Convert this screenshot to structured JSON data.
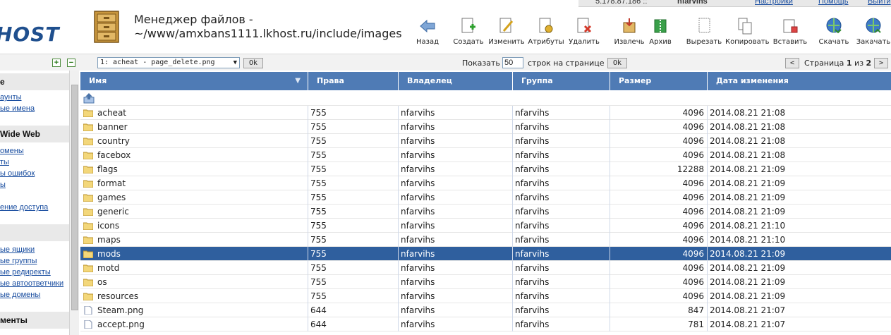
{
  "top": {
    "ip": "5.178.87.186 ::",
    "user": "nfarvihs",
    "settings": "Настройки",
    "help": "Помощь",
    "logout": "Выйти"
  },
  "header": {
    "logo": "HOST",
    "title_line1": "Менеджер файлов -",
    "title_line2": "~/www/amxbans1111.lkhost.ru/include/images"
  },
  "toolbar": [
    {
      "label": "Назад",
      "icon": "back-arrow-icon"
    },
    {
      "label": "Создать",
      "icon": "create-file-icon"
    },
    {
      "label": "Изменить",
      "icon": "edit-file-icon"
    },
    {
      "label": "Атрибуты",
      "icon": "attributes-icon"
    },
    {
      "label": "Удалить",
      "icon": "delete-file-icon"
    },
    {
      "label": "Извлечь",
      "icon": "extract-icon"
    },
    {
      "label": "Архив",
      "icon": "archive-icon"
    },
    {
      "label": "Вырезать",
      "icon": "cut-icon"
    },
    {
      "label": "Копировать",
      "icon": "copy-icon"
    },
    {
      "label": "Вставить",
      "icon": "paste-icon"
    },
    {
      "label": "Скачать",
      "icon": "download-icon"
    },
    {
      "label": "Закачать",
      "icon": "upload-icon"
    }
  ],
  "subbar": {
    "select_value": "1: acheat - page_delete.png",
    "ok": "Ok",
    "show_label": "Показать",
    "per_page": "50",
    "rows_label": "строк на странице",
    "prev": "<",
    "page_label": "Страница",
    "page_current": "1",
    "page_of": "из",
    "page_total": "2",
    "next": ">"
  },
  "sidebar": {
    "sections": [
      {
        "title": "e",
        "links": [
          "аунты",
          "ые имена"
        ]
      },
      {
        "title": "Wide Web",
        "links": [
          "омены",
          "ты",
          "ы ошибок",
          "ы",
          "ение доступа"
        ]
      },
      {
        "title": "",
        "links": [
          "ые ящики",
          "ые группы",
          "ые редиректы",
          "ые автоответчики",
          "ые домены"
        ]
      },
      {
        "title": "менты",
        "links": []
      }
    ]
  },
  "table": {
    "headers": [
      "Имя",
      "Права",
      "Владелец",
      "Группа",
      "Размер",
      "Дата изменения"
    ],
    "rows": [
      {
        "name": "acheat",
        "type": "folder",
        "perm": "755",
        "owner": "nfarvihs",
        "group": "nfarvihs",
        "size": "4096",
        "date": "2014.08.21 21:08"
      },
      {
        "name": "banner",
        "type": "folder",
        "perm": "755",
        "owner": "nfarvihs",
        "group": "nfarvihs",
        "size": "4096",
        "date": "2014.08.21 21:08"
      },
      {
        "name": "country",
        "type": "folder",
        "perm": "755",
        "owner": "nfarvihs",
        "group": "nfarvihs",
        "size": "4096",
        "date": "2014.08.21 21:08"
      },
      {
        "name": "facebox",
        "type": "folder",
        "perm": "755",
        "owner": "nfarvihs",
        "group": "nfarvihs",
        "size": "4096",
        "date": "2014.08.21 21:08"
      },
      {
        "name": "flags",
        "type": "folder",
        "perm": "755",
        "owner": "nfarvihs",
        "group": "nfarvihs",
        "size": "12288",
        "date": "2014.08.21 21:09"
      },
      {
        "name": "format",
        "type": "folder",
        "perm": "755",
        "owner": "nfarvihs",
        "group": "nfarvihs",
        "size": "4096",
        "date": "2014.08.21 21:09"
      },
      {
        "name": "games",
        "type": "folder",
        "perm": "755",
        "owner": "nfarvihs",
        "group": "nfarvihs",
        "size": "4096",
        "date": "2014.08.21 21:09"
      },
      {
        "name": "generic",
        "type": "folder",
        "perm": "755",
        "owner": "nfarvihs",
        "group": "nfarvihs",
        "size": "4096",
        "date": "2014.08.21 21:09"
      },
      {
        "name": "icons",
        "type": "folder",
        "perm": "755",
        "owner": "nfarvihs",
        "group": "nfarvihs",
        "size": "4096",
        "date": "2014.08.21 21:10"
      },
      {
        "name": "maps",
        "type": "folder",
        "perm": "755",
        "owner": "nfarvihs",
        "group": "nfarvihs",
        "size": "4096",
        "date": "2014.08.21 21:10"
      },
      {
        "name": "mods",
        "type": "folder",
        "perm": "755",
        "owner": "nfarvihs",
        "group": "nfarvihs",
        "size": "4096",
        "date": "2014.08.21 21:09",
        "selected": true
      },
      {
        "name": "motd",
        "type": "folder",
        "perm": "755",
        "owner": "nfarvihs",
        "group": "nfarvihs",
        "size": "4096",
        "date": "2014.08.21 21:09"
      },
      {
        "name": "os",
        "type": "folder",
        "perm": "755",
        "owner": "nfarvihs",
        "group": "nfarvihs",
        "size": "4096",
        "date": "2014.08.21 21:09"
      },
      {
        "name": "resources",
        "type": "folder",
        "perm": "755",
        "owner": "nfarvihs",
        "group": "nfarvihs",
        "size": "4096",
        "date": "2014.08.21 21:09"
      },
      {
        "name": "Steam.png",
        "type": "file",
        "perm": "644",
        "owner": "nfarvihs",
        "group": "nfarvihs",
        "size": "847",
        "date": "2014.08.21 21:07"
      },
      {
        "name": "accept.png",
        "type": "file",
        "perm": "644",
        "owner": "nfarvihs",
        "group": "nfarvihs",
        "size": "781",
        "date": "2014.08.21 21:07"
      }
    ]
  },
  "colors": {
    "header_bg": "#4f7bb5",
    "selected_bg": "#2f5f9e",
    "link": "#1a4ea0",
    "logo": "#1f4f8e"
  }
}
